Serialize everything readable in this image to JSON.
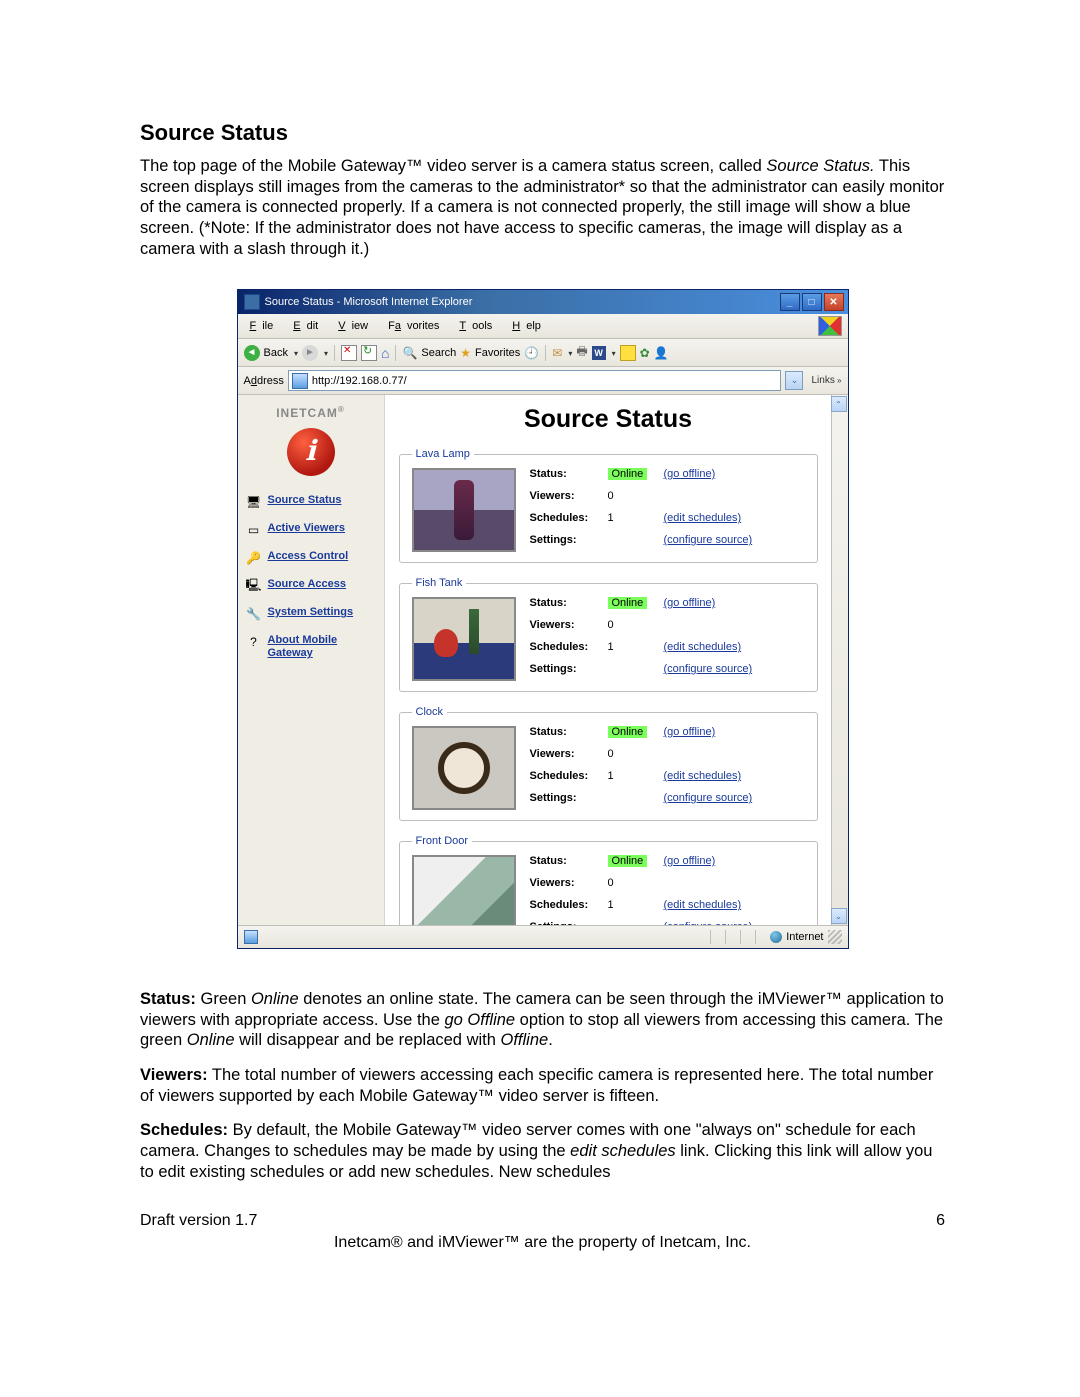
{
  "doc": {
    "heading": "Source Status",
    "intro_html": "The top page of the Mobile Gateway™ video server is a camera status screen, called <i>Source Status.</i> This screen displays still images from the cameras to the administrator* so that the administrator can easily monitor of the camera is connected properly. If a camera is not connected properly, the still image will show a blue screen. (*Note: If the administrator does not have access to specific cameras, the image will display as a camera with a slash through it.)",
    "p_status": "<b>Status:</b> Green <i>Online</i> denotes an online state. The camera can be seen through the iMViewer™ application to viewers with appropriate access. Use the <i>go Offline</i> option to stop all viewers from accessing this camera. The green <i>Online</i> will disappear and be replaced with <i>Offline</i>.",
    "p_viewers": "<b>Viewers:</b> The total number of viewers accessing each specific camera is represented here. The total number of viewers supported by each Mobile Gateway™ video server is fifteen.",
    "p_schedules": "<b>Schedules:</b>  By default, the Mobile Gateway™ video server comes with one \"always on\" schedule for each camera. Changes to schedules may be made by using the <i>edit schedules</i> link. Clicking this link will allow you to edit existing schedules or add new schedules. New schedules",
    "footer_left": "Draft version 1.7",
    "footer_right": "6",
    "footer_center": "Inetcam® and iMViewer™ are the property of Inetcam, Inc."
  },
  "window": {
    "title": "Source Status - Microsoft Internet Explorer",
    "menus": {
      "file": "File",
      "edit": "Edit",
      "view": "View",
      "favorites": "Favorites",
      "tools": "Tools",
      "help": "Help"
    },
    "toolbar": {
      "back": "Back",
      "search": "Search",
      "favorites": "Favorites"
    },
    "address_label": "Address",
    "url": "http://192.168.0.77/",
    "links_label": "Links",
    "status_zone": "Internet"
  },
  "sidebar": {
    "brand": "INETCAM",
    "items": [
      {
        "icon": "🖥",
        "label": "Source Status"
      },
      {
        "icon": "▭",
        "label": "Active Viewers"
      },
      {
        "icon": "🔑",
        "label": "Access Control"
      },
      {
        "icon": "🖳",
        "label": "Source Access"
      },
      {
        "icon": "🔧",
        "label": "System Settings"
      },
      {
        "icon": "?",
        "label": "About Mobile Gateway"
      }
    ]
  },
  "main": {
    "title": "Source Status",
    "labels": {
      "status": "Status:",
      "viewers": "Viewers:",
      "schedules": "Schedules:",
      "settings": "Settings:"
    },
    "badge_online": "Online",
    "links": {
      "go_offline": "(go offline)",
      "edit_schedules": "(edit schedules)",
      "configure": "(configure source)"
    },
    "sources": [
      {
        "name": "Lava Lamp",
        "thumb": "lava",
        "viewers": "0",
        "schedules": "1"
      },
      {
        "name": "Fish Tank",
        "thumb": "fish",
        "viewers": "0",
        "schedules": "1"
      },
      {
        "name": "Clock",
        "thumb": "clock",
        "viewers": "0",
        "schedules": "1"
      },
      {
        "name": "Front Door",
        "thumb": "door",
        "viewers": "0",
        "schedules": "1"
      }
    ]
  }
}
